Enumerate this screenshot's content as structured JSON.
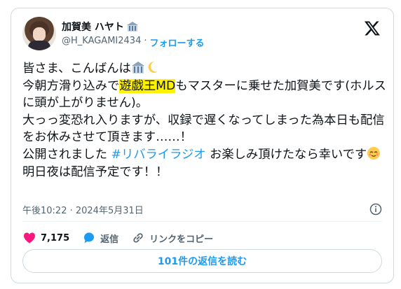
{
  "author": {
    "display_name": "加賀美 ハヤト",
    "handle": "@H_KAGAMI2434",
    "separator": "·",
    "follow_label": "フォローする",
    "badge_icon": "building-icon"
  },
  "post": {
    "line1": "皆さま、こんばんは",
    "line2a": "今朝方滑り込みで",
    "line2_highlight": "遊戯王MD",
    "line2b": "もマスターに乗せた加賀美です(ホルスに頭が上がりません)。",
    "line3": "大っっ変恐れ入りますが、収録で遅くなってしまった為本日も配信をお休みさせて頂きます……！",
    "line4a": "公開されました ",
    "hashtag": "#リバライラジオ",
    "line4b": " お楽しみ頂けたなら幸いです",
    "line5": "明日夜は配信予定です！！"
  },
  "timestamp": "午後10:22 · 2024年5月31日",
  "actions": {
    "likes_count": "7,175",
    "reply_label": "返信",
    "copy_link_label": "リンクをコピー"
  },
  "replies_button_label": "101件の返信を読む",
  "colors": {
    "accent": "#1d9bf0",
    "like": "#f91880",
    "highlight": "#fff200"
  }
}
